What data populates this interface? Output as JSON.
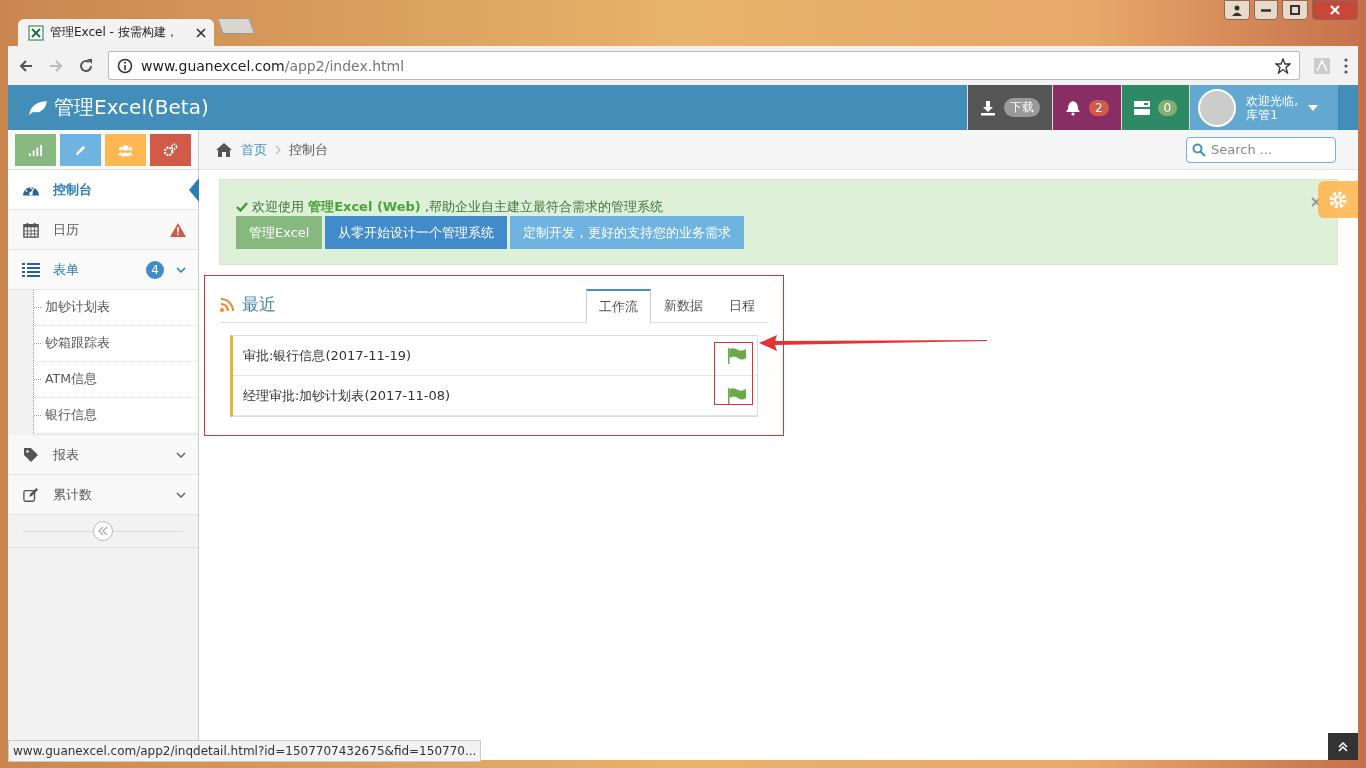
{
  "browser": {
    "tab_title": "管理Excel - 按需构建，",
    "url_host": "www.guanexcel.com",
    "url_path": "/app2/index.html",
    "status_url": "www.guanexcel.com/app2/inqdetail.html?id=1507707432675&fid=150770..."
  },
  "header": {
    "brand": "管理Excel(Beta)",
    "download_label": "下载",
    "notification_count": "2",
    "task_count": "0",
    "user_greeting": "欢迎光临,",
    "user_name": "库管1"
  },
  "sidebar": {
    "shortcuts": [
      {
        "kind": "chart",
        "color": "#87b87f"
      },
      {
        "kind": "pencil",
        "color": "#6fb3e0"
      },
      {
        "kind": "users",
        "color": "#ffb752"
      },
      {
        "kind": "cogs",
        "color": "#d15b47"
      }
    ],
    "items": [
      {
        "kind": "dashboard",
        "label": "控制台",
        "selected": true
      },
      {
        "kind": "calendar",
        "label": "日历",
        "selected": false,
        "alert": true
      },
      {
        "kind": "list",
        "label": "表单",
        "selected": false,
        "badge": "4",
        "expanded": true,
        "children": [
          {
            "label": "加钞计划表"
          },
          {
            "label": "钞箱跟踪表"
          },
          {
            "label": "ATM信息"
          },
          {
            "label": "银行信息"
          }
        ]
      },
      {
        "kind": "tag",
        "label": "报表",
        "selected": false,
        "expanded": false
      },
      {
        "kind": "edit",
        "label": "累计数",
        "selected": false,
        "expanded": false
      }
    ]
  },
  "breadcrumb": [
    "首页",
    "控制台"
  ],
  "search": {
    "placeholder": "Search ..."
  },
  "alert": {
    "message": "欢迎使用 **管理Excel (Web)** ,帮助企业自主建立最符合需求的管理系统",
    "buttons": [
      {
        "label": "管理Excel",
        "color": "#87b87f"
      },
      {
        "label": "从零开始设计一个管理系统",
        "color": "#428bca"
      },
      {
        "label": "定制开发，更好的支持您的业务需求",
        "color": "#6fb3e0"
      }
    ]
  },
  "recent": {
    "title": "最近",
    "tabs": [
      {
        "label": "工作流",
        "selected": true
      },
      {
        "label": "新数据",
        "selected": false
      },
      {
        "label": "日程",
        "selected": false
      }
    ],
    "items": [
      {
        "text": "审批:银行信息(2017-11-19)"
      },
      {
        "text": "经理审批:加钞计划表(2017-11-08)"
      }
    ]
  }
}
